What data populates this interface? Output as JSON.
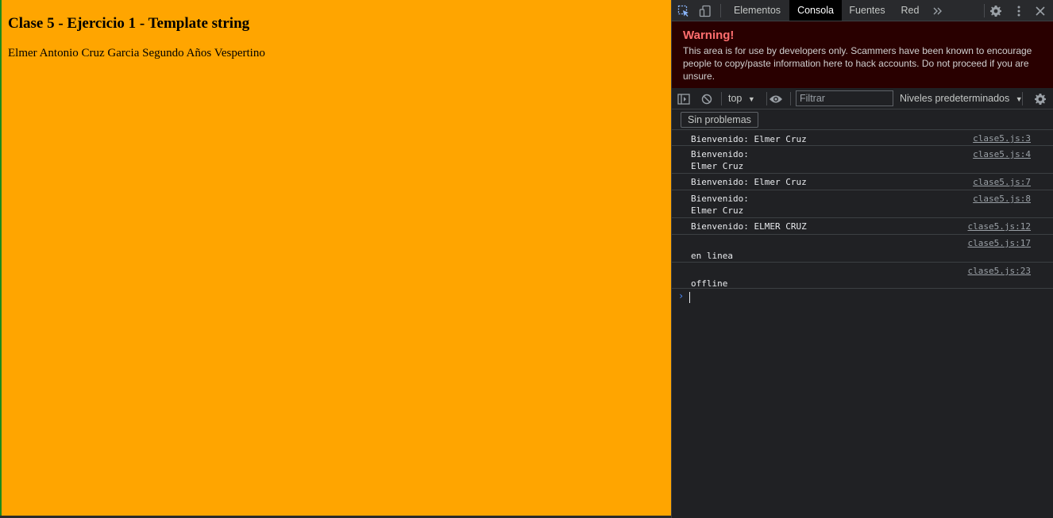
{
  "page": {
    "title": "Clase 5 - Ejercicio 1 - Template string",
    "text": "Elmer Antonio Cruz Garcia Segundo Años Vespertino",
    "background": "#ffa500"
  },
  "devtools": {
    "tabs": [
      {
        "label": "Elementos",
        "active": false
      },
      {
        "label": "Consola",
        "active": true
      },
      {
        "label": "Fuentes",
        "active": false
      },
      {
        "label": "Red",
        "active": false
      }
    ],
    "icons": {
      "inspect": "inspect-element-icon",
      "device": "device-toolbar-icon",
      "more_tabs": "double-chevron-icon",
      "settings": "gear-icon",
      "menu": "kebab-menu-icon",
      "close": "close-icon"
    },
    "warning": {
      "title": "Warning!",
      "text": "This area is for use by developers only. Scammers have been known to encourage people to copy/paste information here to hack accounts. Do not proceed if you are unsure."
    },
    "toolbar": {
      "context": "top",
      "filter_placeholder": "Filtrar",
      "levels": "Niveles predeterminados",
      "issues": "Sin problemas"
    },
    "messages": [
      {
        "text": "Bienvenido: Elmer Cruz",
        "source": "clase5.js:3"
      },
      {
        "text": "Bienvenido:\nElmer Cruz",
        "source": "clase5.js:4"
      },
      {
        "text": "Bienvenido: Elmer Cruz",
        "source": "clase5.js:7"
      },
      {
        "text": "Bienvenido:\nElmer Cruz",
        "source": "clase5.js:8"
      },
      {
        "text": "Bienvenido: ELMER CRUZ",
        "source": "clase5.js:12"
      },
      {
        "text": "\nen linea",
        "source": "clase5.js:17"
      },
      {
        "text": "\noffline",
        "source": "clase5.js:23"
      }
    ],
    "colors": {
      "warning_title": "#ff6e6e",
      "warning_bg": "#290000",
      "prompt": "#4e8cff"
    }
  }
}
